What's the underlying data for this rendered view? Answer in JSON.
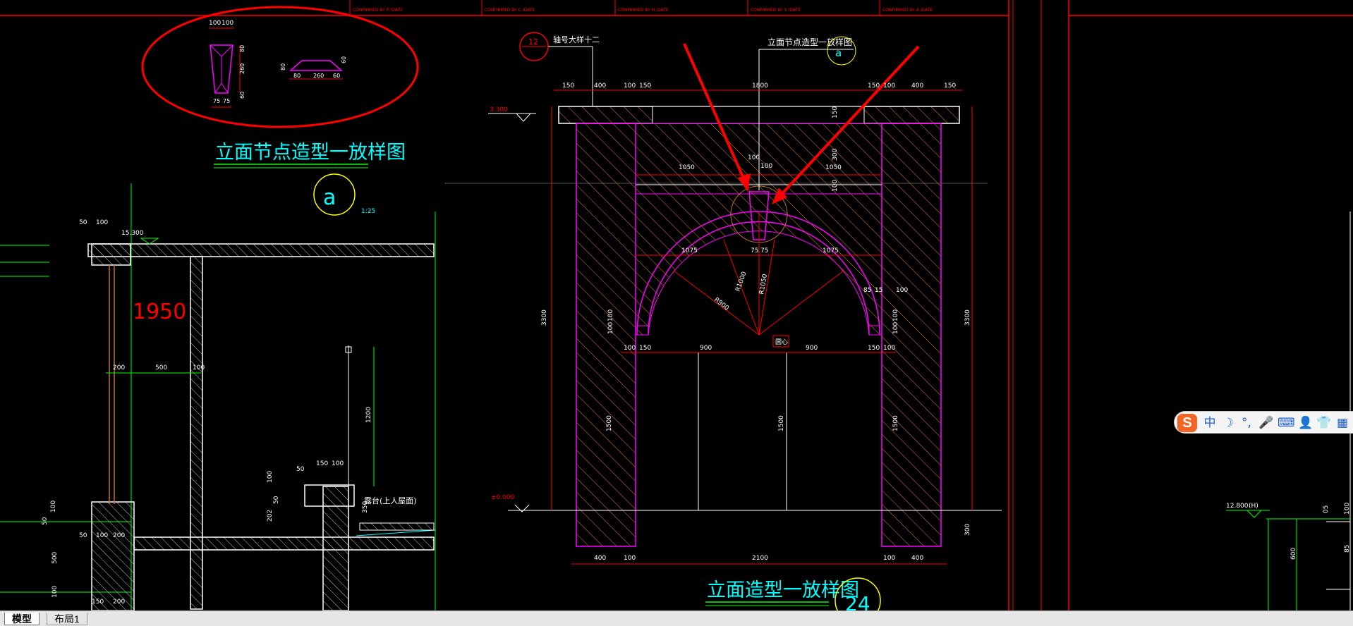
{
  "drawing": {
    "title_block": [
      "CONFIRMED BY P /DATE",
      "CONFIRMED BY C /DATE",
      "CONFIRMED BY H /DATE",
      "CONFIRMED BY S /DATE",
      "CONFIRMED BY A /DATE"
    ],
    "detail_a": {
      "title": "立面节点造型一放样图",
      "marker": "a",
      "scale": "1:25",
      "dims_top": [
        "100",
        "100"
      ],
      "dims_side": [
        "80",
        "260",
        "60"
      ],
      "dims_bottom": [
        "75",
        "75"
      ],
      "dims_profile": [
        "80",
        "260",
        "60"
      ],
      "dims_profile_side": [
        "80",
        "60"
      ]
    },
    "section_left": {
      "big_label": "1950",
      "elev_top": "15.300",
      "dims": [
        "50",
        "100",
        "200",
        "500",
        "100",
        "1200",
        "150",
        "100",
        "50",
        "100",
        "202",
        "50",
        "350"
      ],
      "roof_label": "露台(上人屋面)",
      "left_dims": [
        "50",
        "100",
        "50",
        "100",
        "200",
        "500",
        "150",
        "200",
        "100"
      ]
    },
    "elevation": {
      "title": "立面造型一放样图",
      "number": "24",
      "callout_num": "12",
      "callout_text": "轴号大样十二",
      "top_ref_text": "立面节点造型一放样图",
      "top_ref_marker": "a",
      "top_dims": [
        "150",
        "400",
        "100",
        "150",
        "1800",
        "150",
        "100",
        "400",
        "150"
      ],
      "mid_dims": [
        "1050",
        "100",
        "100",
        "1050"
      ],
      "side_dims": [
        "150",
        "300",
        "100"
      ],
      "arc_dims": [
        "1075",
        "75",
        "75",
        "1075"
      ],
      "radii": [
        "R900",
        "R1000",
        "R1050"
      ],
      "small_dims": [
        "85",
        "15",
        "100"
      ],
      "left_total": "3300",
      "right_total": "3300",
      "springing_dims": [
        "100",
        "150",
        "900",
        "900",
        "150",
        "100"
      ],
      "center_mark": "圆心",
      "vert_dims": [
        "1500",
        "1500",
        "1500"
      ],
      "left_small": [
        "100",
        "100"
      ],
      "right_small": [
        "100",
        "100"
      ],
      "bottom_dims": [
        "400",
        "100",
        "2100",
        "100",
        "400"
      ],
      "right_bottom": "300",
      "elev_left": "3.300",
      "elev_bottom": "±0.000"
    },
    "right_panel": {
      "elev": "12.800",
      "label": "(H)",
      "dims": [
        "05",
        "100",
        "600",
        "85"
      ]
    }
  },
  "tabs": [
    {
      "label": "模型",
      "active": true
    },
    {
      "label": "布局1",
      "active": false
    }
  ],
  "ime": {
    "logo": "S",
    "buttons": [
      "中",
      "☽",
      "°,",
      "🎤",
      "⌨",
      "👤",
      "👕",
      "▦"
    ]
  },
  "colors": {
    "background": "#000000",
    "cyan": "#00ffff",
    "red": "#ff0000",
    "magenta": "#ff00ff",
    "white": "#ffffff",
    "green": "#00ff00",
    "yellow": "#ffff00",
    "brown": "#c07030"
  }
}
